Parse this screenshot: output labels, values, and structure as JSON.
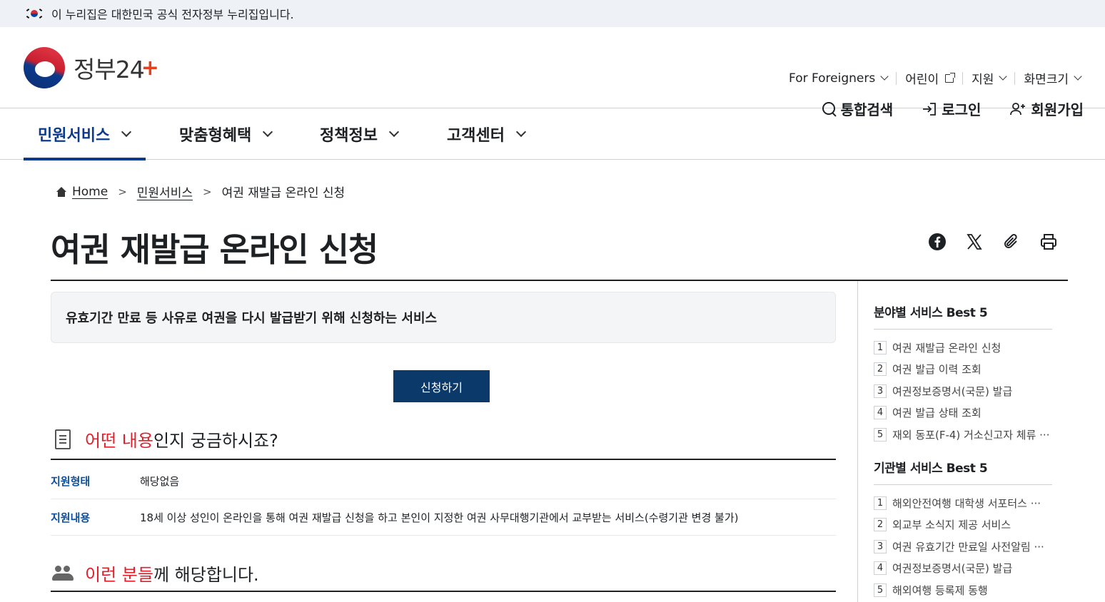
{
  "gov_banner": {
    "text": "이 누리집은 대한민국 공식 전자정부 누리집입니다."
  },
  "logo": {
    "text": "정부24"
  },
  "util_nav": [
    {
      "label": "For Foreigners"
    },
    {
      "label": "어린이"
    },
    {
      "label": "지원"
    },
    {
      "label": "화면크기"
    }
  ],
  "actions": {
    "search": "통합검색",
    "login": "로그인",
    "signup": "회원가입"
  },
  "gnb": [
    {
      "label": "민원서비스"
    },
    {
      "label": "맞춤형혜택"
    },
    {
      "label": "정책정보"
    },
    {
      "label": "고객센터"
    }
  ],
  "breadcrumb": {
    "home": "Home",
    "level1": "민원서비스",
    "current": "여권 재발급 온라인 신청"
  },
  "page_title": "여권 재발급 온라인 신청",
  "share_icons": [
    "facebook-icon",
    "x-icon",
    "link-icon",
    "print-icon"
  ],
  "summary": "유효기간 만료 등 사유로 여권을 다시 발급받기 위해 신청하는 서비스",
  "apply_button": "신청하기",
  "section1": {
    "highlight": "어떤 내용",
    "rest": "인지 궁금하시죠?"
  },
  "info_rows": [
    {
      "key": "지원형태",
      "value": "해당없음"
    },
    {
      "key": "지원내용",
      "value": "18세 이상 성인이 온라인을 통해 여권 재발급 신청을 하고 본인이 지정한 여권 사무대행기관에서 교부받는 서비스(수령기관 변경 불가)"
    }
  ],
  "section2": {
    "highlight": "이런 분들",
    "rest": "께 해당합니다."
  },
  "sidebar": {
    "field_title": "분야별 서비스 Best 5",
    "field_items": [
      {
        "num": "1",
        "label": "여권 재발급 온라인 신청"
      },
      {
        "num": "2",
        "label": "여권 발급 이력 조회"
      },
      {
        "num": "3",
        "label": "여권정보증명서(국문) 발급"
      },
      {
        "num": "4",
        "label": "여권 발급 상태 조회"
      },
      {
        "num": "5",
        "label": "재외 동포(F-4) 거소신고자 체류 ···"
      }
    ],
    "agency_title": "기관별 서비스 Best 5",
    "agency_items": [
      {
        "num": "1",
        "label": "해외안전여행 대학생 서포터스 ···"
      },
      {
        "num": "2",
        "label": "외교부 소식지 제공 서비스"
      },
      {
        "num": "3",
        "label": "여권 유효기간 만료일 사전알림 ···"
      },
      {
        "num": "4",
        "label": "여권정보증명서(국문) 발급"
      },
      {
        "num": "5",
        "label": "해외여행 등록제 동행"
      }
    ]
  },
  "colors": {
    "brand_navy": "#0b3a6a",
    "accent_red": "#e01f2b",
    "link_blue": "#0b50a0"
  }
}
